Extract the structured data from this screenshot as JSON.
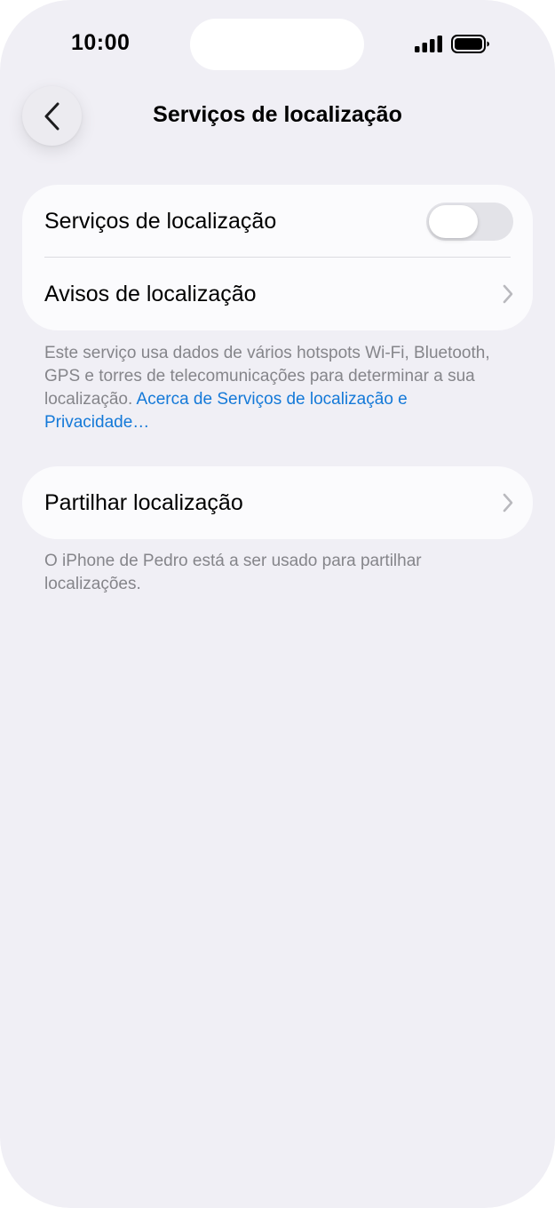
{
  "status_bar": {
    "time": "10:00",
    "icons": [
      "cellular-signal-icon",
      "battery-icon"
    ]
  },
  "nav": {
    "back_icon": "chevron-left-icon",
    "title": "Serviços de localização"
  },
  "group1": {
    "rows": [
      {
        "label": "Serviços de localização",
        "control": "toggle",
        "toggle_on": false
      },
      {
        "label": "Avisos de localização",
        "control": "chevron-right-icon"
      }
    ]
  },
  "footnote1": {
    "text": "Este serviço usa dados de vários hotspots Wi-Fi, Bluetooth, GPS e torres de telecomunicações para determinar a sua localização. ",
    "link": "Acerca de Serviços de localização e Privacidade…"
  },
  "group2": {
    "rows": [
      {
        "label": "Partilhar localização",
        "control": "chevron-right-icon"
      }
    ]
  },
  "footnote2": {
    "text": "O iPhone de Pedro está a ser usado para partilhar localizações."
  },
  "colors": {
    "background": "#f0eff5",
    "card": "#fbfbfd",
    "link": "#1479d8",
    "secondary_text": "#85858a",
    "toggle_off": "#e3e3e8"
  }
}
